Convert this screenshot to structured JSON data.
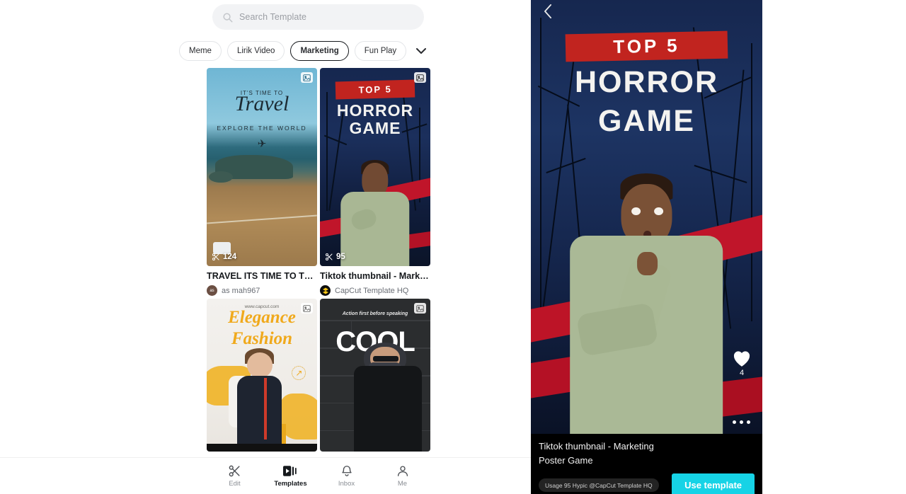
{
  "search": {
    "placeholder": "Search Template",
    "icon": "search-icon"
  },
  "filters": {
    "chips": [
      {
        "label": "Meme",
        "active": false,
        "cut": true
      },
      {
        "label": "Lirik Video",
        "active": false
      },
      {
        "label": "Marketing",
        "active": true
      },
      {
        "label": "Fun Play",
        "active": false
      }
    ],
    "more_icon": "chevron-down-icon"
  },
  "templates": [
    {
      "title": "TRAVEL ITS TIME TO TRA...",
      "author": "as mah967",
      "avatar_initials": "as",
      "uses": "124",
      "badge_icon": "image-icon",
      "art": {
        "headline_small": "IT'S TIME TO",
        "headline_script": "Travel",
        "subtitle": "EXPLORE THE WORLD"
      }
    },
    {
      "title": "Tiktok thumbnail - Market...",
      "author": "CapCut Template HQ",
      "avatar_initials": "",
      "uses": "95",
      "badge_icon": "image-icon",
      "art": {
        "banner": "TOP 5",
        "line1": "HORROR",
        "line2": "GAME"
      }
    },
    {
      "title": "",
      "author": "",
      "uses": "",
      "badge_icon": "image-icon",
      "art": {
        "url": "www.capcut.com",
        "line1": "Elegance",
        "line2": "Fashion",
        "arrow": "↗"
      }
    },
    {
      "title": "",
      "author": "",
      "uses": "",
      "badge_icon": "image-icon",
      "art": {
        "subtitle": "Action first before\nspeaking",
        "headline": "COOL"
      }
    }
  ],
  "bottom_nav": [
    {
      "label": "Edit",
      "icon": "scissors-icon",
      "active": false
    },
    {
      "label": "Templates",
      "icon": "video-templates-icon",
      "active": true
    },
    {
      "label": "Inbox",
      "icon": "bell-icon",
      "active": false
    },
    {
      "label": "Me",
      "icon": "person-icon",
      "active": false
    }
  ],
  "preview": {
    "back_icon": "chevron-left-icon",
    "art": {
      "banner": "TOP 5",
      "line1": "HORROR",
      "line2": "GAME"
    },
    "like": {
      "icon": "heart-icon",
      "count": "4"
    },
    "carousel_dots": 3,
    "title_line1": "Tiktok thumbnail - Marketing",
    "title_line2": "Poster Game",
    "usage_badge": "Usage 95 Hypic @CapCut Template HQ",
    "use_button": "Use template",
    "accent_color": "#16d3e6"
  }
}
